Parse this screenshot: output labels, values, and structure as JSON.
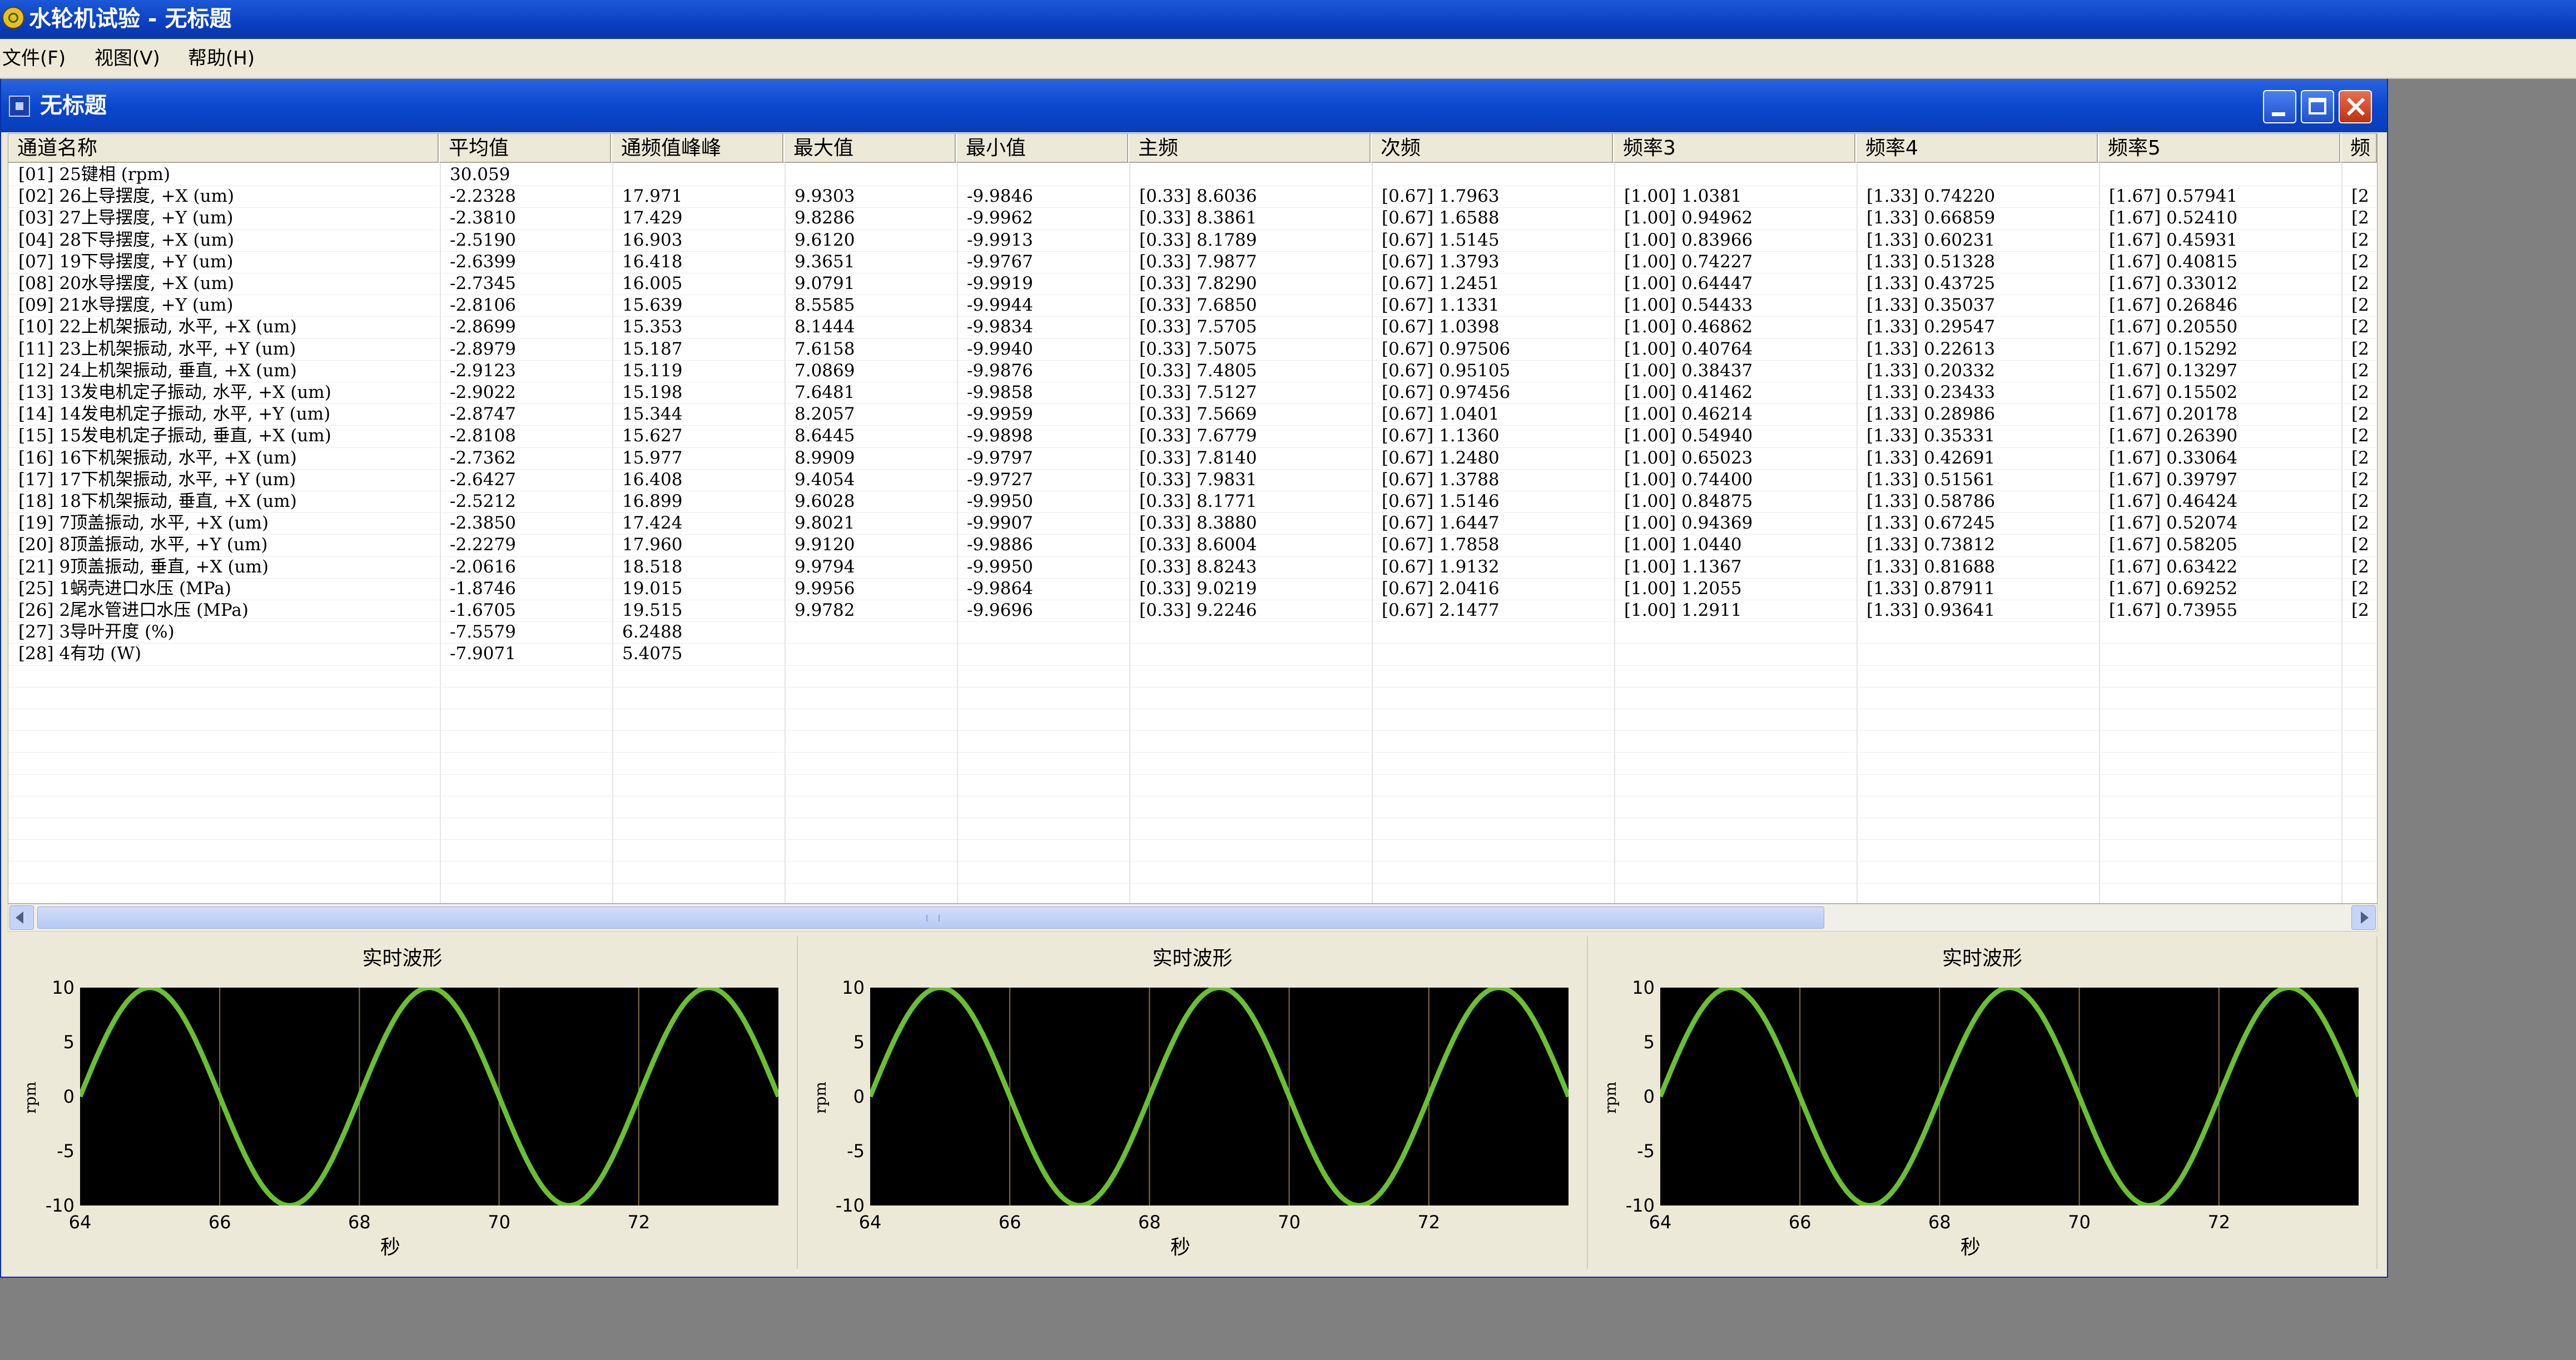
{
  "app": {
    "title": "水轮机试验 - 无标题",
    "icon": "turbine-app-icon"
  },
  "menu": [
    "文件(F)",
    "视图(V)",
    "帮助(H)"
  ],
  "document": {
    "title": "无标题"
  },
  "table": {
    "columns": [
      "通道名称",
      "平均值",
      "通频值峰峰",
      "最大值",
      "最小值",
      "主频",
      "次频",
      "频率3",
      "频率4",
      "频率5",
      "频"
    ],
    "rows": [
      [
        "[01] 25键相 (rpm)",
        "30.059",
        "",
        "",
        "",
        "",
        "",
        "",
        "",
        "",
        ""
      ],
      [
        "[02] 26上导摆度, +X (um)",
        "-2.2328",
        "17.971",
        "9.9303",
        "-9.9846",
        "[0.33] 8.6036",
        "[0.67] 1.7963",
        "[1.00] 1.0381",
        "[1.33] 0.74220",
        "[1.67] 0.57941",
        "[2"
      ],
      [
        "[03] 27上导摆度, +Y (um)",
        "-2.3810",
        "17.429",
        "9.8286",
        "-9.9962",
        "[0.33] 8.3861",
        "[0.67] 1.6588",
        "[1.00] 0.94962",
        "[1.33] 0.66859",
        "[1.67] 0.52410",
        "[2"
      ],
      [
        "[04] 28下导摆度, +X (um)",
        "-2.5190",
        "16.903",
        "9.6120",
        "-9.9913",
        "[0.33] 8.1789",
        "[0.67] 1.5145",
        "[1.00] 0.83966",
        "[1.33] 0.60231",
        "[1.67] 0.45931",
        "[2"
      ],
      [
        "[07] 19下导摆度, +Y (um)",
        "-2.6399",
        "16.418",
        "9.3651",
        "-9.9767",
        "[0.33] 7.9877",
        "[0.67] 1.3793",
        "[1.00] 0.74227",
        "[1.33] 0.51328",
        "[1.67] 0.40815",
        "[2"
      ],
      [
        "[08] 20水导摆度, +X (um)",
        "-2.7345",
        "16.005",
        "9.0791",
        "-9.9919",
        "[0.33] 7.8290",
        "[0.67] 1.2451",
        "[1.00] 0.64447",
        "[1.33] 0.43725",
        "[1.67] 0.33012",
        "[2"
      ],
      [
        "[09] 21水导摆度, +Y (um)",
        "-2.8106",
        "15.639",
        "8.5585",
        "-9.9944",
        "[0.33] 7.6850",
        "[0.67] 1.1331",
        "[1.00] 0.54433",
        "[1.33] 0.35037",
        "[1.67] 0.26846",
        "[2"
      ],
      [
        "[10] 22上机架振动, 水平, +X (um)",
        "-2.8699",
        "15.353",
        "8.1444",
        "-9.9834",
        "[0.33] 7.5705",
        "[0.67] 1.0398",
        "[1.00] 0.46862",
        "[1.33] 0.29547",
        "[1.67] 0.20550",
        "[2"
      ],
      [
        "[11] 23上机架振动, 水平, +Y (um)",
        "-2.8979",
        "15.187",
        "7.6158",
        "-9.9940",
        "[0.33] 7.5075",
        "[0.67] 0.97506",
        "[1.00] 0.40764",
        "[1.33] 0.22613",
        "[1.67] 0.15292",
        "[2"
      ],
      [
        "[12] 24上机架振动, 垂直, +X (um)",
        "-2.9123",
        "15.119",
        "7.0869",
        "-9.9876",
        "[0.33] 7.4805",
        "[0.67] 0.95105",
        "[1.00] 0.38437",
        "[1.33] 0.20332",
        "[1.67] 0.13297",
        "[2"
      ],
      [
        "[13] 13发电机定子振动, 水平, +X (um)",
        "-2.9022",
        "15.198",
        "7.6481",
        "-9.9858",
        "[0.33] 7.5127",
        "[0.67] 0.97456",
        "[1.00] 0.41462",
        "[1.33] 0.23433",
        "[1.67] 0.15502",
        "[2"
      ],
      [
        "[14] 14发电机定子振动, 水平, +Y (um)",
        "-2.8747",
        "15.344",
        "8.2057",
        "-9.9959",
        "[0.33] 7.5669",
        "[0.67] 1.0401",
        "[1.00] 0.46214",
        "[1.33] 0.28986",
        "[1.67] 0.20178",
        "[2"
      ],
      [
        "[15] 15发电机定子振动, 垂直, +X (um)",
        "-2.8108",
        "15.627",
        "8.6445",
        "-9.9898",
        "[0.33] 7.6779",
        "[0.67] 1.1360",
        "[1.00] 0.54940",
        "[1.33] 0.35331",
        "[1.67] 0.26390",
        "[2"
      ],
      [
        "[16] 16下机架振动, 水平, +X (um)",
        "-2.7362",
        "15.977",
        "8.9909",
        "-9.9797",
        "[0.33] 7.8140",
        "[0.67] 1.2480",
        "[1.00] 0.65023",
        "[1.33] 0.42691",
        "[1.67] 0.33064",
        "[2"
      ],
      [
        "[17] 17下机架振动, 水平, +Y (um)",
        "-2.6427",
        "16.408",
        "9.4054",
        "-9.9727",
        "[0.33] 7.9831",
        "[0.67] 1.3788",
        "[1.00] 0.74400",
        "[1.33] 0.51561",
        "[1.67] 0.39797",
        "[2"
      ],
      [
        "[18] 18下机架振动, 垂直, +X (um)",
        "-2.5212",
        "16.899",
        "9.6028",
        "-9.9950",
        "[0.33] 8.1771",
        "[0.67] 1.5146",
        "[1.00] 0.84875",
        "[1.33] 0.58786",
        "[1.67] 0.46424",
        "[2"
      ],
      [
        "[19] 7顶盖振动, 水平, +X (um)",
        "-2.3850",
        "17.424",
        "9.8021",
        "-9.9907",
        "[0.33] 8.3880",
        "[0.67] 1.6447",
        "[1.00] 0.94369",
        "[1.33] 0.67245",
        "[1.67] 0.52074",
        "[2"
      ],
      [
        "[20] 8顶盖振动, 水平, +Y (um)",
        "-2.2279",
        "17.960",
        "9.9120",
        "-9.9886",
        "[0.33] 8.6004",
        "[0.67] 1.7858",
        "[1.00] 1.0440",
        "[1.33] 0.73812",
        "[1.67] 0.58205",
        "[2"
      ],
      [
        "[21] 9顶盖振动, 垂直, +X (um)",
        "-2.0616",
        "18.518",
        "9.9794",
        "-9.9950",
        "[0.33] 8.8243",
        "[0.67] 1.9132",
        "[1.00] 1.1367",
        "[1.33] 0.81688",
        "[1.67] 0.63422",
        "[2"
      ],
      [
        "[25] 1蜗壳进口水压 (MPa)",
        "-1.8746",
        "19.015",
        "9.9956",
        "-9.9864",
        "[0.33] 9.0219",
        "[0.67] 2.0416",
        "[1.00] 1.2055",
        "[1.33] 0.87911",
        "[1.67] 0.69252",
        "[2"
      ],
      [
        "[26] 2尾水管进口水压 (MPa)",
        "-1.6705",
        "19.515",
        "9.9782",
        "-9.9696",
        "[0.33] 9.2246",
        "[0.67] 2.1477",
        "[1.00] 1.2911",
        "[1.33] 0.93641",
        "[1.67] 0.73955",
        "[2"
      ],
      [
        "[27] 3导叶开度 (%)",
        "-7.5579",
        "6.2488",
        "",
        "",
        "",
        "",
        "",
        "",
        "",
        ""
      ],
      [
        "[28] 4有功 (W)",
        "-7.9071",
        "5.4075",
        "",
        "",
        "",
        "",
        "",
        "",
        "",
        ""
      ]
    ]
  },
  "scrollbar": {
    "left_icon": "scroll-left-arrow-icon",
    "right_icon": "scroll-right-arrow-icon",
    "position": 0.0
  },
  "charts_panels": [
    {
      "title": "实时波形",
      "ylabel": "rpm",
      "xlabel": "秒"
    },
    {
      "title": "实时波形",
      "ylabel": "rpm",
      "xlabel": "秒"
    },
    {
      "title": "实时波形",
      "ylabel": "rpm",
      "xlabel": "秒"
    }
  ],
  "colors": {
    "trace": "#6ac030",
    "plot_bg": "#000000",
    "grid": "#807040",
    "titlebar": "#0a48d0"
  },
  "chart_data": [
    {
      "type": "line",
      "title": "实时波形",
      "xlabel": "秒",
      "ylabel": "rpm",
      "xlim": [
        64,
        74
      ],
      "ylim": [
        -10,
        10
      ],
      "xticks": [
        64,
        66,
        68,
        70,
        72
      ],
      "yticks": [
        10,
        5,
        0,
        -5,
        -10
      ],
      "grid": "vertical",
      "series": [
        {
          "x": [
            64,
            64.5,
            65,
            65.5,
            66,
            66.5,
            67,
            67.5,
            68,
            68.5,
            69,
            69.5,
            70,
            70.5,
            71,
            71.5,
            72,
            72.5,
            73,
            73.5,
            74
          ],
          "y": [
            0,
            7.07,
            10,
            7.07,
            0,
            -7.07,
            -10,
            -7.07,
            0,
            7.07,
            10,
            7.07,
            0,
            -7.07,
            -10,
            -7.07,
            0,
            7.07,
            10,
            7.07,
            0
          ]
        }
      ]
    },
    {
      "type": "line",
      "title": "实时波形",
      "xlabel": "秒",
      "ylabel": "rpm",
      "xlim": [
        64,
        74
      ],
      "ylim": [
        -10,
        10
      ],
      "xticks": [
        64,
        66,
        68,
        70,
        72
      ],
      "yticks": [
        10,
        5,
        0,
        -5,
        -10
      ],
      "grid": "vertical",
      "series": [
        {
          "x": [
            64,
            64.5,
            65,
            65.5,
            66,
            66.5,
            67,
            67.5,
            68,
            68.5,
            69,
            69.5,
            70,
            70.5,
            71,
            71.5,
            72,
            72.5,
            73,
            73.5,
            74
          ],
          "y": [
            0,
            7.07,
            10,
            7.07,
            0,
            -7.07,
            -10,
            -7.07,
            0,
            7.07,
            10,
            7.07,
            0,
            -7.07,
            -10,
            -7.07,
            0,
            7.07,
            10,
            7.07,
            0
          ]
        }
      ]
    },
    {
      "type": "line",
      "title": "实时波形",
      "xlabel": "秒",
      "ylabel": "rpm",
      "xlim": [
        64,
        74
      ],
      "ylim": [
        -10,
        10
      ],
      "xticks": [
        64,
        66,
        68,
        70,
        72
      ],
      "yticks": [
        10,
        5,
        0,
        -5,
        -10
      ],
      "grid": "vertical",
      "series": [
        {
          "x": [
            64,
            64.5,
            65,
            65.5,
            66,
            66.5,
            67,
            67.5,
            68,
            68.5,
            69,
            69.5,
            70,
            70.5,
            71,
            71.5,
            72,
            72.5,
            73,
            73.5,
            74
          ],
          "y": [
            0,
            7.07,
            10,
            7.07,
            0,
            -7.07,
            -10,
            -7.07,
            0,
            7.07,
            10,
            7.07,
            0,
            -7.07,
            -10,
            -7.07,
            0,
            7.07,
            10,
            7.07,
            0
          ]
        }
      ]
    }
  ]
}
